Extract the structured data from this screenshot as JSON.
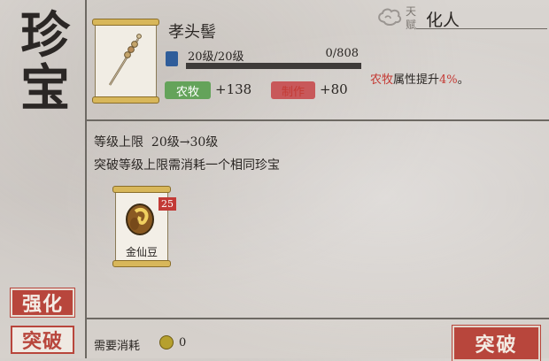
{
  "side": {
    "title_line1": "珍",
    "title_line2": "宝",
    "tabs": [
      {
        "label": "强化",
        "active": true
      },
      {
        "label": "突破",
        "active": false
      }
    ]
  },
  "item": {
    "name": "孝头髻",
    "level_label": "20级/20级",
    "exp_label": "0/808",
    "exp_progress": 1.0,
    "icon": "skewer-hairpin-icon"
  },
  "stats": [
    {
      "tag": "农牧",
      "value": "+138",
      "color": "#64a35a"
    },
    {
      "tag": "制作",
      "value": "+80",
      "color": "#c8585a"
    }
  ],
  "talent": {
    "key_top": "天",
    "key_bottom": "赋",
    "name": "化人"
  },
  "effect": {
    "attr": "农牧",
    "middle": "属性提升",
    "percent": "4%",
    "end": "。"
  },
  "breakthrough": {
    "cap_label": "等级上限",
    "cap_value": "20级→30级",
    "requirement": "突破等级上限需消耗一个相同珍宝"
  },
  "material": {
    "name": "金仙豆",
    "count": "25",
    "icon": "golden-bean-icon"
  },
  "cost": {
    "label": "需要消耗",
    "value": "0",
    "icon": "coin-icon"
  },
  "action": {
    "label": "突破"
  },
  "colors": {
    "accent_red": "#b8463c",
    "green_tag": "#64a35a",
    "red_tag": "#c8585a",
    "highlight_red": "#c43a34"
  }
}
